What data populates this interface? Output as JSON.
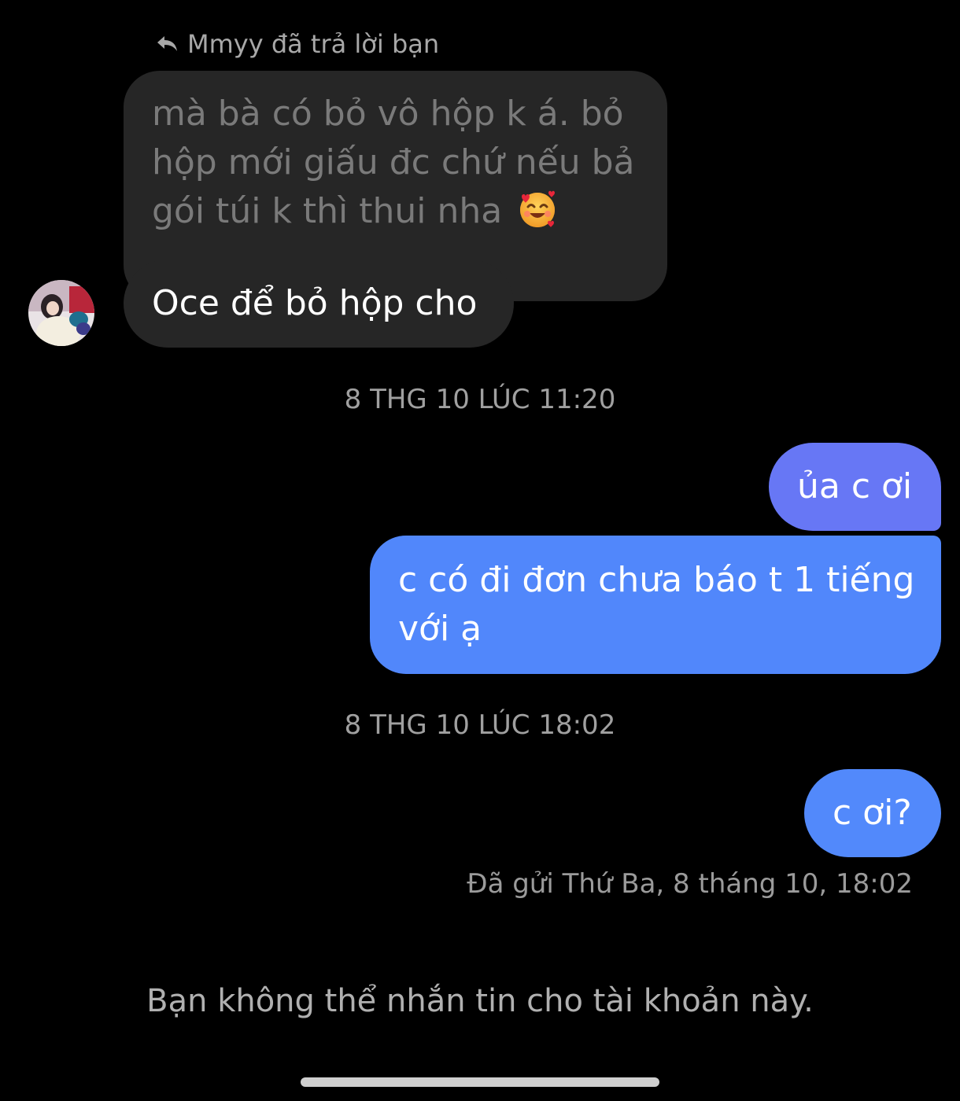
{
  "reply_header": "Mmyy đã trả lời bạn",
  "messages": {
    "incoming_reply_lines": [
      "mà bà có bỏ vô hộp k á. bỏ",
      "hộp mới giấu đc chứ nếu bả",
      "gói túi k thì thui nha"
    ],
    "incoming_reply_emoji": "smiling-face-with-hearts",
    "incoming_message": "Oce để bỏ hộp cho",
    "timestamp_1": "8 THG 10 LÚC 11:20",
    "outgoing_1": "ủa c ơi",
    "outgoing_2_lines": [
      "c có đi đơn chưa báo t 1 tiếng",
      "với ạ"
    ],
    "timestamp_2": "8 THG 10 LÚC 18:02",
    "outgoing_3": "c ơi?"
  },
  "sent_status": "Đã gửi Thứ Ba, 8 tháng 10, 18:02",
  "cannot_message_notice": "Bạn không thể nhắn tin cho tài khoản này.",
  "colors": {
    "background": "#000000",
    "incoming_bubble": "#262626",
    "outgoing_bubble_top": "#6777f5",
    "outgoing_bubble": "#5187fb",
    "muted_text": "#a0a0a0"
  },
  "icons": {
    "reply": "reply-arrow-icon",
    "avatar": "contact-avatar"
  }
}
